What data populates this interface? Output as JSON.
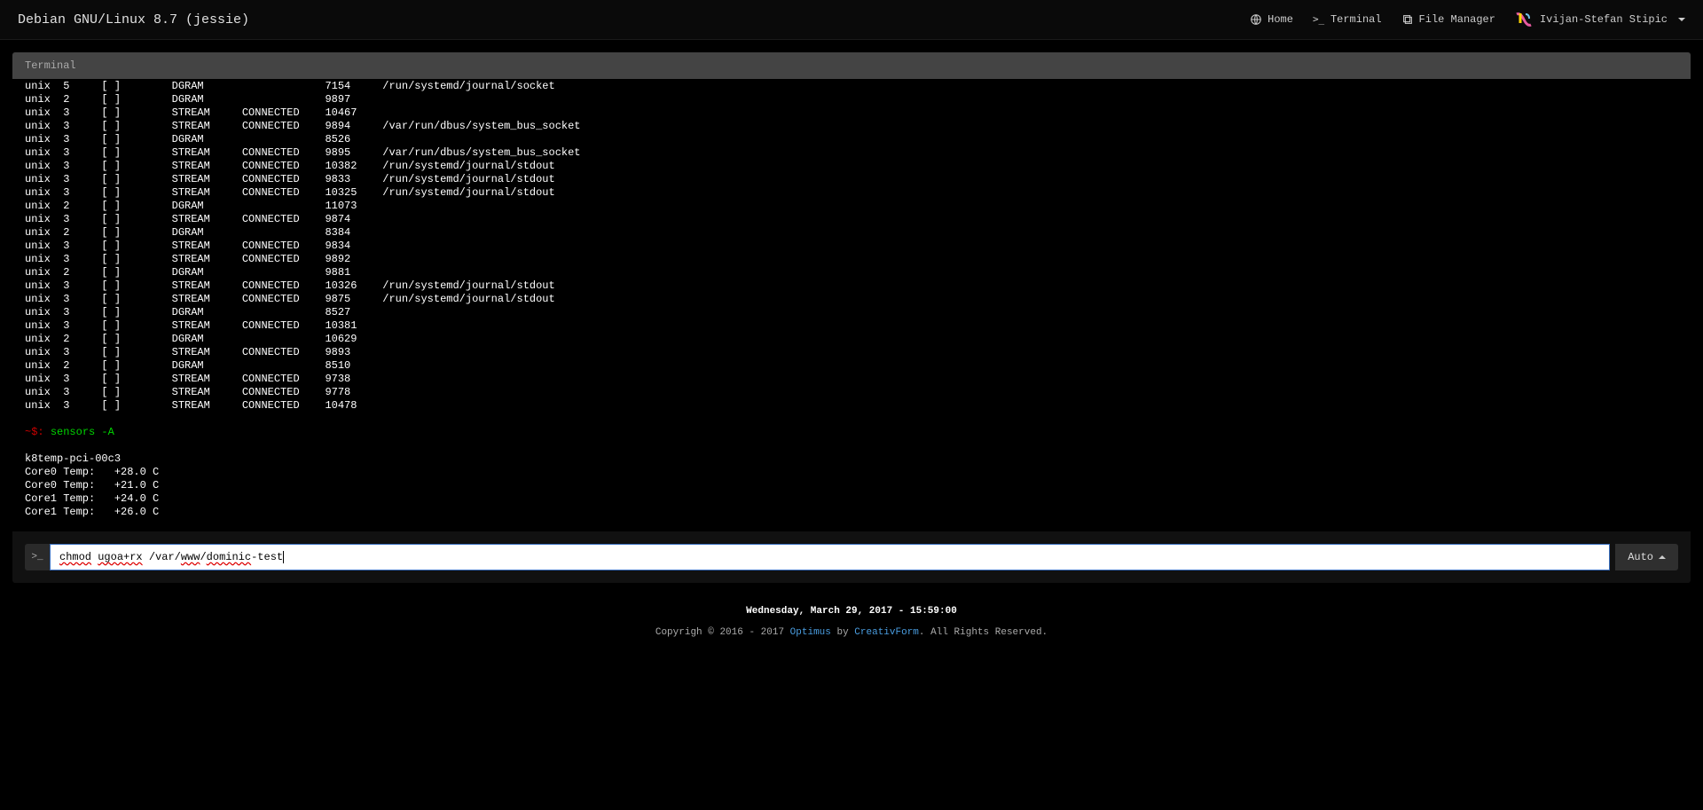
{
  "header": {
    "title": "Debian GNU/Linux 8.7 (jessie)",
    "nav": {
      "home": "Home",
      "terminal": "Terminal",
      "file_manager": "File Manager"
    },
    "user": "Ivijan-Stefan Stipic"
  },
  "terminal": {
    "header": "Terminal",
    "netstat_rows": [
      {
        "proto": "unix",
        "refcnt": "5",
        "flags": "[ ]",
        "type": "DGRAM",
        "state": "",
        "inode": "7154",
        "path": "/run/systemd/journal/socket"
      },
      {
        "proto": "unix",
        "refcnt": "2",
        "flags": "[ ]",
        "type": "DGRAM",
        "state": "",
        "inode": "9897",
        "path": ""
      },
      {
        "proto": "unix",
        "refcnt": "3",
        "flags": "[ ]",
        "type": "STREAM",
        "state": "CONNECTED",
        "inode": "10467",
        "path": ""
      },
      {
        "proto": "unix",
        "refcnt": "3",
        "flags": "[ ]",
        "type": "STREAM",
        "state": "CONNECTED",
        "inode": "9894",
        "path": "/var/run/dbus/system_bus_socket"
      },
      {
        "proto": "unix",
        "refcnt": "3",
        "flags": "[ ]",
        "type": "DGRAM",
        "state": "",
        "inode": "8526",
        "path": ""
      },
      {
        "proto": "unix",
        "refcnt": "3",
        "flags": "[ ]",
        "type": "STREAM",
        "state": "CONNECTED",
        "inode": "9895",
        "path": "/var/run/dbus/system_bus_socket"
      },
      {
        "proto": "unix",
        "refcnt": "3",
        "flags": "[ ]",
        "type": "STREAM",
        "state": "CONNECTED",
        "inode": "10382",
        "path": "/run/systemd/journal/stdout"
      },
      {
        "proto": "unix",
        "refcnt": "3",
        "flags": "[ ]",
        "type": "STREAM",
        "state": "CONNECTED",
        "inode": "9833",
        "path": "/run/systemd/journal/stdout"
      },
      {
        "proto": "unix",
        "refcnt": "3",
        "flags": "[ ]",
        "type": "STREAM",
        "state": "CONNECTED",
        "inode": "10325",
        "path": "/run/systemd/journal/stdout"
      },
      {
        "proto": "unix",
        "refcnt": "2",
        "flags": "[ ]",
        "type": "DGRAM",
        "state": "",
        "inode": "11073",
        "path": ""
      },
      {
        "proto": "unix",
        "refcnt": "3",
        "flags": "[ ]",
        "type": "STREAM",
        "state": "CONNECTED",
        "inode": "9874",
        "path": ""
      },
      {
        "proto": "unix",
        "refcnt": "2",
        "flags": "[ ]",
        "type": "DGRAM",
        "state": "",
        "inode": "8384",
        "path": ""
      },
      {
        "proto": "unix",
        "refcnt": "3",
        "flags": "[ ]",
        "type": "STREAM",
        "state": "CONNECTED",
        "inode": "9834",
        "path": ""
      },
      {
        "proto": "unix",
        "refcnt": "3",
        "flags": "[ ]",
        "type": "STREAM",
        "state": "CONNECTED",
        "inode": "9892",
        "path": ""
      },
      {
        "proto": "unix",
        "refcnt": "2",
        "flags": "[ ]",
        "type": "DGRAM",
        "state": "",
        "inode": "9881",
        "path": ""
      },
      {
        "proto": "unix",
        "refcnt": "3",
        "flags": "[ ]",
        "type": "STREAM",
        "state": "CONNECTED",
        "inode": "10326",
        "path": "/run/systemd/journal/stdout"
      },
      {
        "proto": "unix",
        "refcnt": "3",
        "flags": "[ ]",
        "type": "STREAM",
        "state": "CONNECTED",
        "inode": "9875",
        "path": "/run/systemd/journal/stdout"
      },
      {
        "proto": "unix",
        "refcnt": "3",
        "flags": "[ ]",
        "type": "DGRAM",
        "state": "",
        "inode": "8527",
        "path": ""
      },
      {
        "proto": "unix",
        "refcnt": "3",
        "flags": "[ ]",
        "type": "STREAM",
        "state": "CONNECTED",
        "inode": "10381",
        "path": ""
      },
      {
        "proto": "unix",
        "refcnt": "2",
        "flags": "[ ]",
        "type": "DGRAM",
        "state": "",
        "inode": "10629",
        "path": ""
      },
      {
        "proto": "unix",
        "refcnt": "3",
        "flags": "[ ]",
        "type": "STREAM",
        "state": "CONNECTED",
        "inode": "9893",
        "path": ""
      },
      {
        "proto": "unix",
        "refcnt": "2",
        "flags": "[ ]",
        "type": "DGRAM",
        "state": "",
        "inode": "8510",
        "path": ""
      },
      {
        "proto": "unix",
        "refcnt": "3",
        "flags": "[ ]",
        "type": "STREAM",
        "state": "CONNECTED",
        "inode": "9738",
        "path": ""
      },
      {
        "proto": "unix",
        "refcnt": "3",
        "flags": "[ ]",
        "type": "STREAM",
        "state": "CONNECTED",
        "inode": "9778",
        "path": ""
      },
      {
        "proto": "unix",
        "refcnt": "3",
        "flags": "[ ]",
        "type": "STREAM",
        "state": "CONNECTED",
        "inode": "10478",
        "path": ""
      }
    ],
    "prompt": {
      "symbol": "~$:",
      "command": "sensors -A"
    },
    "sensors": {
      "adapter": "k8temp-pci-00c3",
      "lines": [
        "Core0 Temp:   +28.0 C",
        "Core0 Temp:   +21.0 C",
        "Core1 Temp:   +24.0 C",
        "Core1 Temp:   +26.0 C"
      ]
    }
  },
  "command_input": {
    "parts": [
      {
        "text": "chmod",
        "err": true
      },
      {
        "text": " ",
        "err": false
      },
      {
        "text": "ugoa+rx",
        "err": true
      },
      {
        "text": " /var/",
        "err": false
      },
      {
        "text": "www",
        "err": true
      },
      {
        "text": "/",
        "err": false
      },
      {
        "text": "dominic",
        "err": true
      },
      {
        "text": "-test",
        "err": false
      }
    ],
    "auto_label": "Auto"
  },
  "footer": {
    "datetime": "Wednesday, March 29, 2017 - 15:59:00",
    "copyright_pre": "Copyrigh © 2016 - 2017 ",
    "link1": "Optimus",
    "mid": " by ",
    "link2": "CreativForm",
    "copyright_post": ". All Rights Reserved."
  }
}
